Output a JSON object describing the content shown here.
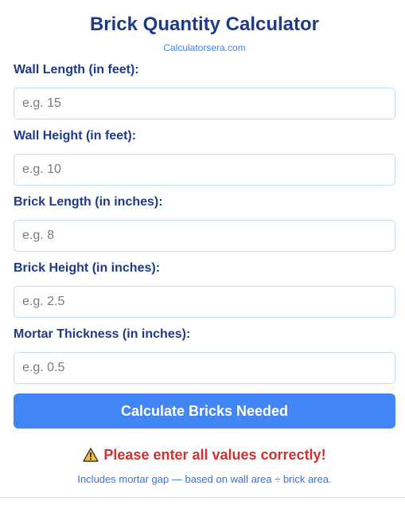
{
  "header": {
    "title": "Brick Quantity Calculator",
    "subtitle": "Calculatorsera.com"
  },
  "fields": [
    {
      "label": "Wall Length (in feet):",
      "placeholder": "e.g. 15",
      "value": ""
    },
    {
      "label": "Wall Height (in feet):",
      "placeholder": "e.g. 10",
      "value": ""
    },
    {
      "label": "Brick Length (in inches):",
      "placeholder": "e.g. 8",
      "value": ""
    },
    {
      "label": "Brick Height (in inches):",
      "placeholder": "e.g. 2.5",
      "value": ""
    },
    {
      "label": "Mortar Thickness (in inches):",
      "placeholder": "e.g. 0.5",
      "value": ""
    }
  ],
  "actions": {
    "calculate_label": "Calculate Bricks Needed"
  },
  "result": {
    "icon": "warning-icon",
    "error_text": "Please enter all values correctly!",
    "note": "Includes mortar gap — based on wall area ÷ brick area."
  },
  "colors": {
    "title": "#1f3a8a",
    "accent": "#4285f4",
    "error": "#d32f2f",
    "link": "#3b82f6"
  }
}
